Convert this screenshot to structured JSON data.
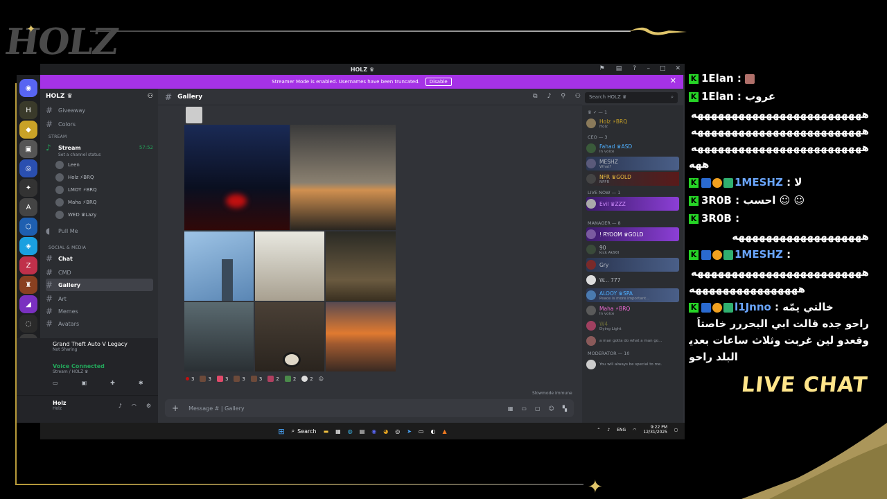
{
  "overlay": {
    "logo": "HOLZ",
    "live_chat_label": "LIVE CHAT"
  },
  "window": {
    "title": "HOLZ ♛",
    "banner_text": "Streamer Mode is enabled. Usernames have been truncated.",
    "banner_button": "Disable"
  },
  "server": {
    "name": "HOLZ ♛"
  },
  "channels": {
    "giveaway": "Giveaway",
    "colors": "Colors",
    "cat_stream": "STREAM",
    "stream": "Stream",
    "stream_time": "57:52",
    "stream_status": "Set a channel status",
    "voice_users": [
      {
        "name": "Leen"
      },
      {
        "name": "Holz ⚡BRQ"
      },
      {
        "name": "LMOY ⚡BRQ"
      },
      {
        "name": "Maha ⚡BRQ"
      },
      {
        "name": "WED ♛Lazy"
      }
    ],
    "pull_me": "Pull Me",
    "cat_social": "SOCIAL & MEDIA",
    "chat": "Chat",
    "gallery": "Gallery",
    "cmd": "CMD",
    "art": "Art",
    "memes": "Memes",
    "avatars": "Avatars"
  },
  "activity": {
    "game": "Grand Theft Auto V Legacy",
    "status": "Not Sharing"
  },
  "voice": {
    "status": "Voice Connected",
    "location": "Stream / HOLZ ♛"
  },
  "user": {
    "name": "Holz",
    "tag": "Holz"
  },
  "channel_header": {
    "name": "Gallery",
    "search_placeholder": "Search HOLZ ♛"
  },
  "reactions": [
    {
      "count": "3"
    },
    {
      "count": "3"
    },
    {
      "count": "3"
    },
    {
      "count": "3"
    },
    {
      "count": "3"
    },
    {
      "count": "2"
    },
    {
      "count": "2"
    },
    {
      "count": "2"
    }
  ],
  "composer": {
    "placeholder": "Message # | Gallery",
    "slowmode": "Slowmode Immune"
  },
  "members": {
    "groups": [
      {
        "label": "♛ ✓ — 1"
      },
      {
        "label": "CEO — 3"
      },
      {
        "label": "LIVE NOW — 1"
      },
      {
        "label": "MANAGER — 8"
      },
      {
        "label": "MODERATOR — 10"
      }
    ],
    "list": [
      {
        "name": "Holz ⚡BRQ",
        "sub": "Holz",
        "color": "#c9a227"
      },
      {
        "name": "Fahad ♛ASD",
        "sub": "In voice",
        "color": "#4fb0ff"
      },
      {
        "name": "MESHZ",
        "sub": "What?",
        "color": "#b5bac1"
      },
      {
        "name": "NFR ♛GOLD",
        "sub": "NFFR",
        "color": "#f0c040"
      },
      {
        "name": "Evil ♛ZZZ",
        "sub": "",
        "color": "#d08cff"
      },
      {
        "name": "! RYOOM ♛GOLD",
        "sub": "",
        "color": "#ffffff"
      },
      {
        "name": "90",
        "sub": "kick Ak90I",
        "color": "#b5bac1"
      },
      {
        "name": "Gry",
        "sub": "",
        "color": "#b5bac1"
      },
      {
        "name": "W... 777",
        "sub": "",
        "color": "#b5bac1"
      },
      {
        "name": "ALOOY ♛SPA",
        "sub": "Peace is more important...",
        "color": "#4fb0ff"
      },
      {
        "name": "Maha ⚡BRQ",
        "sub": "In voice",
        "color": "#f06bd6"
      },
      {
        "name": "W4",
        "sub": "Dying Light",
        "color": "#6b6b3a"
      },
      {
        "name": "",
        "sub": "a man gotta do what a man go...",
        "color": "#b5bac1"
      },
      {
        "name": "",
        "sub": "You will always be special to me.",
        "color": "#b5bac1"
      }
    ]
  },
  "taskbar": {
    "search": "Search",
    "lang": "ENG",
    "time": "9:22 PM",
    "date": "12/31/2025"
  },
  "chat": {
    "lines": [
      {
        "user": "1Elan",
        "sep": " : ",
        "msg": ""
      },
      {
        "user": "1Elan",
        "sep": " : ",
        "msg": "عروب"
      },
      {
        "user": "",
        "sep": "",
        "msg": "هههههههههههههههههههههههههه"
      },
      {
        "user": "",
        "sep": "",
        "msg": "هههههههههههههههههههههههههه"
      },
      {
        "user": "",
        "sep": "",
        "msg": "هههههههههههههههههههههههههه"
      },
      {
        "user": "",
        "sep": "",
        "msg": "ههه"
      },
      {
        "user": "1MESHZ",
        "sep": " : ",
        "msg": "لا"
      },
      {
        "user": "3R0B",
        "sep": " : ",
        "msg": "احسب"
      },
      {
        "user": "3R0B",
        "sep": " : ",
        "msg": ""
      },
      {
        "user": "",
        "sep": "",
        "msg": "هههههههههههههههههههه"
      },
      {
        "user": "1MESHZ",
        "sep": " : ",
        "msg": ""
      },
      {
        "user": "",
        "sep": "",
        "msg": "هههههههههههههههههههههههههه"
      },
      {
        "user": "",
        "sep": "",
        "msg": "ههههههههههههههههه"
      },
      {
        "user": "l1Jnno",
        "sep": " : ",
        "msg": "خالتي يمّه"
      },
      {
        "user": "",
        "sep": "",
        "msg": "راحو جده قالت ابي البحررر خاصتاً"
      },
      {
        "user": "",
        "sep": "",
        "msg": "وقعدو لين غربت وثلاث ساعات بعدين"
      },
      {
        "user": "",
        "sep": "",
        "msg": "البلد راحو"
      }
    ]
  }
}
